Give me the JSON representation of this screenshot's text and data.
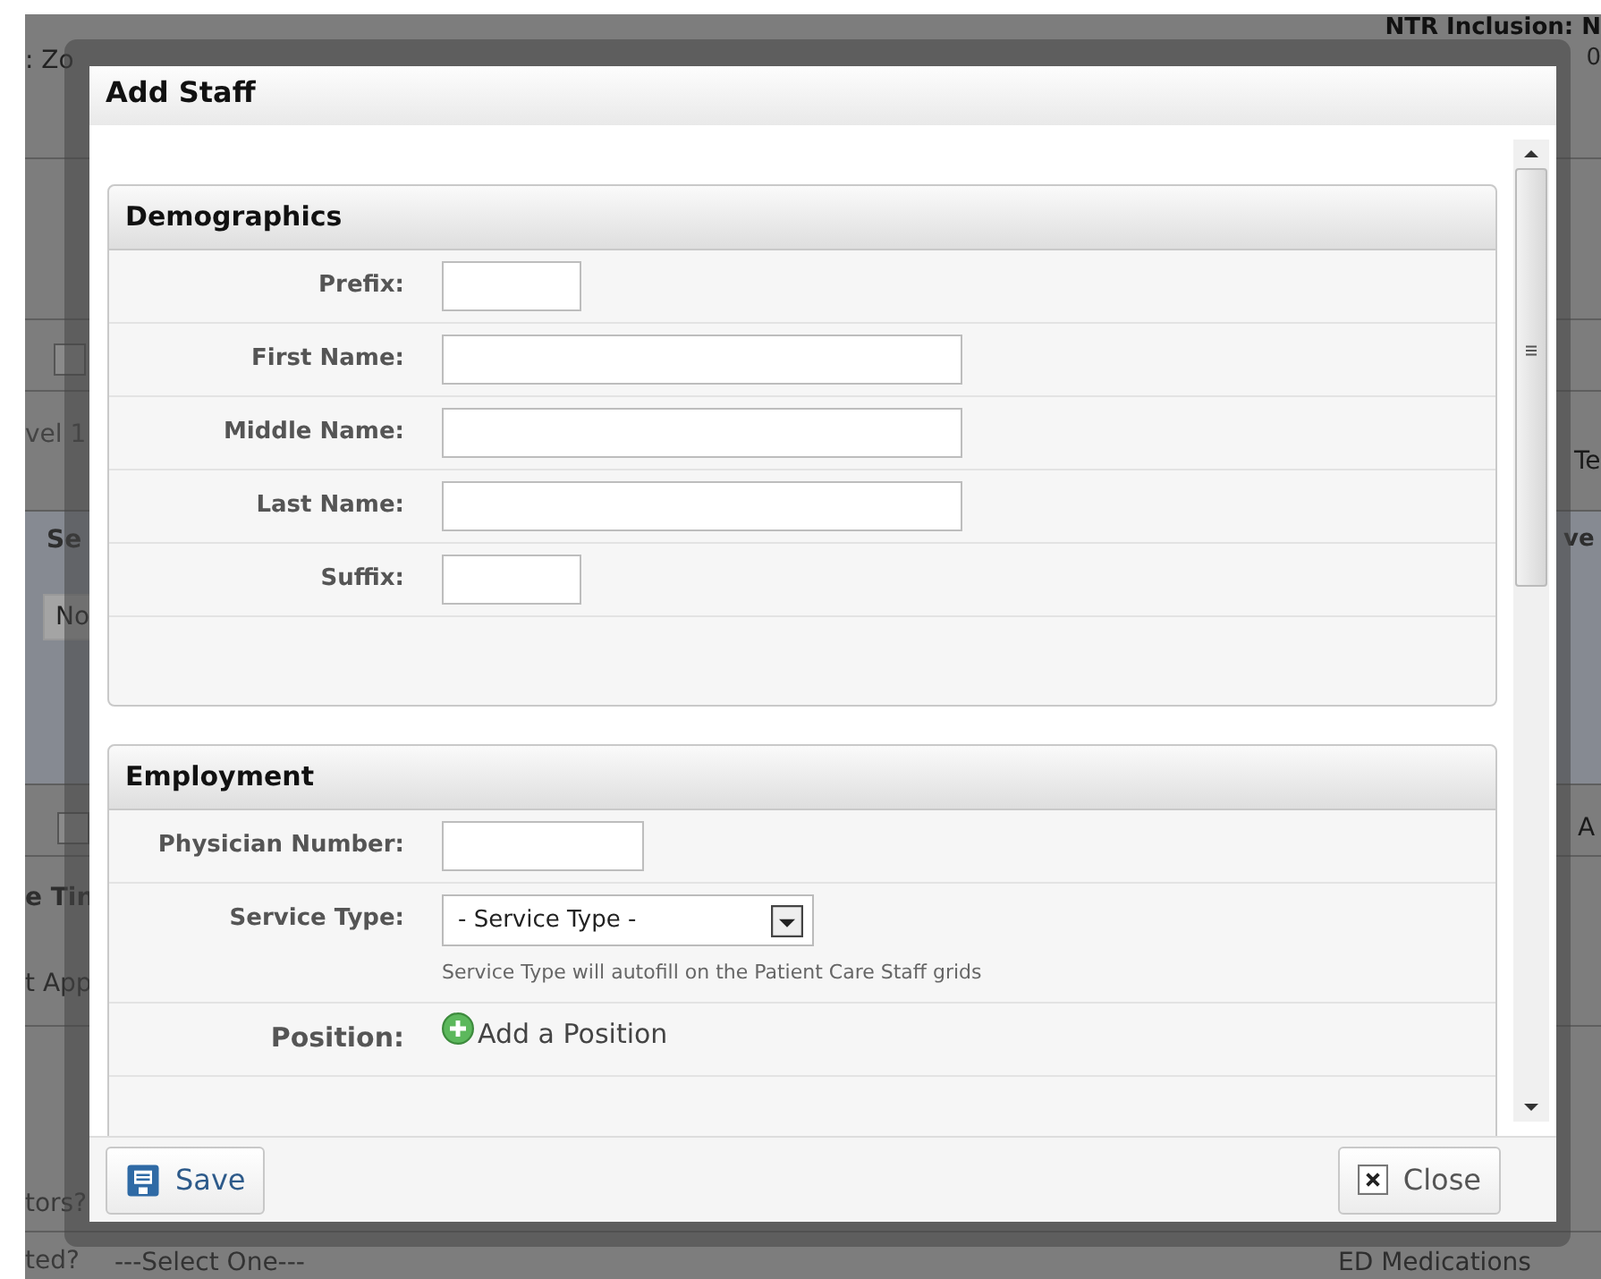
{
  "background": {
    "texts": [
      {
        "text": "NTR Inclusion: N",
        "kind": "bold"
      },
      {
        "text": "0",
        "kind": "plain"
      },
      {
        "text": ": Zo",
        "kind": "plain"
      },
      {
        "text": "vel 1",
        "kind": "plain"
      },
      {
        "text": "Se",
        "kind": "bold"
      },
      {
        "text": "No",
        "kind": "field"
      },
      {
        "text": "e Tin",
        "kind": "bold"
      },
      {
        "text": "t App",
        "kind": "plain"
      },
      {
        "text": "tors?",
        "kind": "plain"
      },
      {
        "text": "ted?",
        "kind": "plain"
      },
      {
        "text": "---Select One---",
        "kind": "select"
      },
      {
        "text": "ED Medications",
        "kind": "plain"
      },
      {
        "text": "Te",
        "kind": "plain"
      },
      {
        "text": "ve",
        "kind": "bold"
      },
      {
        "text": "A",
        "kind": "plain"
      }
    ]
  },
  "dialog": {
    "title": "Add Staff",
    "sections": [
      {
        "title": "Demographics",
        "fields": [
          {
            "label": "Prefix:",
            "kind": "text"
          },
          {
            "label": "First Name:",
            "kind": "text"
          },
          {
            "label": "Middle Name:",
            "kind": "text"
          },
          {
            "label": "Last Name:",
            "kind": "text"
          },
          {
            "label": "Suffix:",
            "kind": "text"
          }
        ]
      },
      {
        "title": "Employment",
        "fields": [
          {
            "label": "Physician Number:",
            "kind": "text"
          },
          {
            "label": "Service Type:",
            "kind": "select",
            "value": "- Service Type -",
            "hint": "Service Type will autofill on the Patient Care Staff grids"
          },
          {
            "label": "Position:",
            "kind": "action",
            "action": "Add a Position"
          }
        ]
      }
    ],
    "buttons": [
      {
        "label": "Save",
        "kind": "save"
      },
      {
        "label": "Close",
        "kind": "close"
      }
    ]
  }
}
